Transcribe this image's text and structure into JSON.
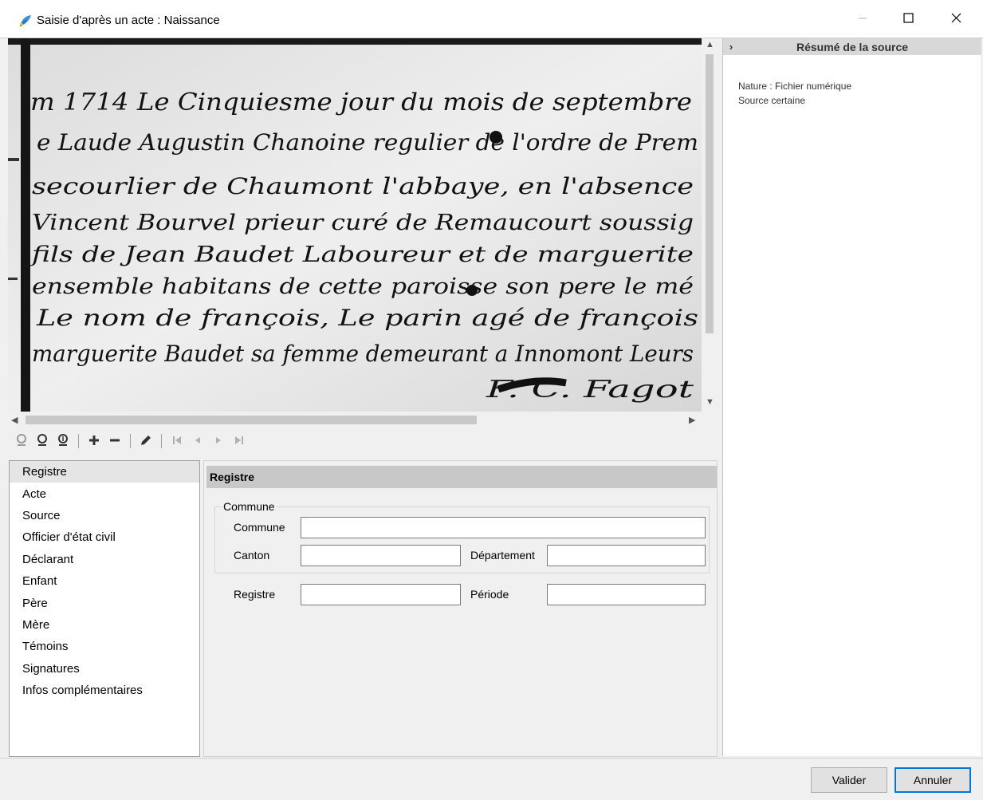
{
  "window": {
    "title": "Saisie d'après un acte : Naissance",
    "icon": "feather-icon",
    "minimize_icon": "minimize-icon",
    "maximize_icon": "maximize-icon",
    "close_icon": "close-icon"
  },
  "viewer": {
    "image_alt": "Scan d'acte manuscrit",
    "scroll_up": "scroll-up-arrow",
    "scroll_down": "scroll-down-arrow",
    "scroll_left": "scroll-left-arrow",
    "scroll_right": "scroll-right-arrow",
    "handwriting": [
      "m 1714   Le Cinquiesme jour du mois de septembre",
      "e Laude Augustin Chanoine regulier de l'ordre de Prem",
      "secourlier de Chaumont l'abbaye, en l'absence",
      "Vincent Bourvel prieur curé de Remaucourt soussig",
      "fils de Jean Baudet Laboureur et de marguerite",
      "ensemble habitans de cette paroisse son pere le mé",
      "Le nom de françois, Le parin agé de françois",
      "marguerite Baudet sa femme demeurant a Innomont Leurs",
      "F. C. Fagot"
    ]
  },
  "toolbar": {
    "buttons": [
      {
        "name": "zoom-100-icon",
        "glyph": "⚲"
      },
      {
        "name": "zoom-fit-icon",
        "glyph": "⚲"
      },
      {
        "name": "zoom-width-icon",
        "glyph": "⚲"
      },
      {
        "name": "zoom-in-icon",
        "glyph": "+"
      },
      {
        "name": "zoom-out-icon",
        "glyph": "−"
      },
      {
        "name": "pencil-icon",
        "glyph": "✎"
      },
      {
        "name": "first-page-icon",
        "glyph": "⏮"
      },
      {
        "name": "previous-page-icon",
        "glyph": "◀"
      },
      {
        "name": "next-page-icon",
        "glyph": "▶"
      },
      {
        "name": "last-page-icon",
        "glyph": "⏭"
      }
    ]
  },
  "nav": {
    "items": [
      {
        "label": "Registre",
        "active": true
      },
      {
        "label": "Acte"
      },
      {
        "label": "Source"
      },
      {
        "label": "Officier d'état civil"
      },
      {
        "label": "Déclarant"
      },
      {
        "label": "Enfant"
      },
      {
        "label": "Père"
      },
      {
        "label": "Mère"
      },
      {
        "label": "Témoins"
      },
      {
        "label": "Signatures"
      },
      {
        "label": "Infos complémentaires"
      }
    ]
  },
  "form": {
    "header": "Registre",
    "group_legend": "Commune",
    "commune_label": "Commune",
    "commune_value": "",
    "canton_label": "Canton",
    "canton_value": "",
    "departement_label": "Département",
    "departement_value": "",
    "registre_label": "Registre",
    "registre_value": "",
    "periode_label": "Période",
    "periode_value": ""
  },
  "side": {
    "chevron": "›",
    "title": "Résumé de la source",
    "nature": "Nature : Fichier numérique",
    "certainty": "Source certaine"
  },
  "actions": {
    "validate": "Valider",
    "cancel": "Annuler"
  },
  "colors": {
    "accent": "#0078d7",
    "selected_nav": "#e5e5e5",
    "header_gray": "#c8c8c8"
  }
}
